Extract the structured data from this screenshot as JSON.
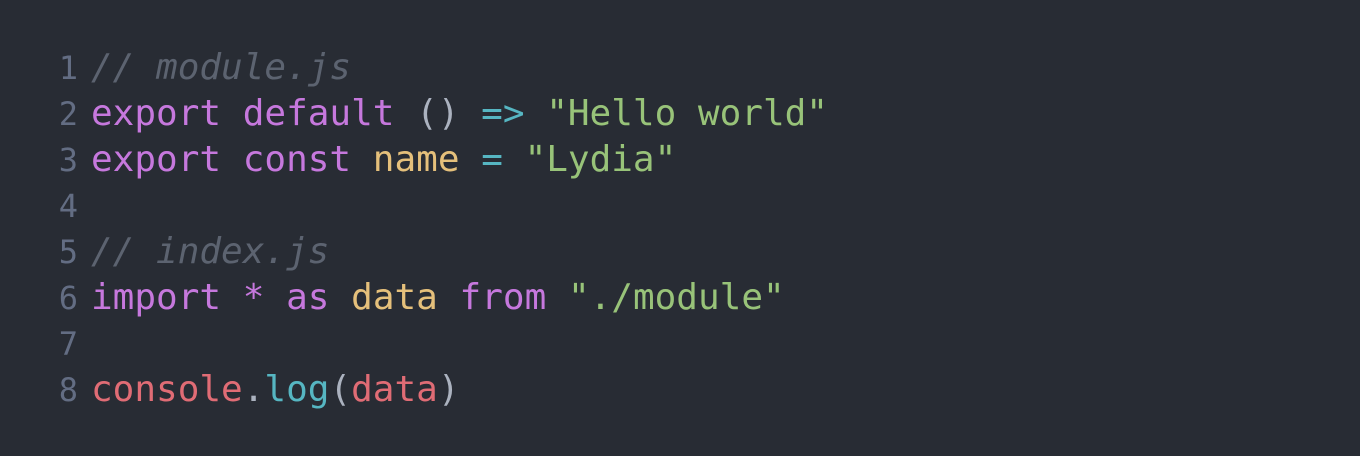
{
  "colors": {
    "background": "#282c34",
    "line_number": "#636d83",
    "comment": "#5c6370",
    "keyword": "#c678dd",
    "operator": "#56b6c2",
    "string": "#98c379",
    "variable": "#e5c07b",
    "plain": "#abb2bf",
    "object": "#e06c75",
    "method": "#56b6c2"
  },
  "code": {
    "lines": [
      {
        "number": "1",
        "tokens": [
          {
            "text": "// module.js",
            "type": "comment"
          }
        ]
      },
      {
        "number": "2",
        "tokens": [
          {
            "text": "export",
            "type": "keyword"
          },
          {
            "text": " ",
            "type": "plain"
          },
          {
            "text": "default",
            "type": "keyword"
          },
          {
            "text": " () ",
            "type": "plain"
          },
          {
            "text": "=>",
            "type": "operator"
          },
          {
            "text": " ",
            "type": "plain"
          },
          {
            "text": "\"Hello world\"",
            "type": "string"
          }
        ]
      },
      {
        "number": "3",
        "tokens": [
          {
            "text": "export",
            "type": "keyword"
          },
          {
            "text": " ",
            "type": "plain"
          },
          {
            "text": "const",
            "type": "keyword"
          },
          {
            "text": " ",
            "type": "plain"
          },
          {
            "text": "name",
            "type": "variable"
          },
          {
            "text": " ",
            "type": "plain"
          },
          {
            "text": "=",
            "type": "operator"
          },
          {
            "text": " ",
            "type": "plain"
          },
          {
            "text": "\"Lydia\"",
            "type": "string"
          }
        ]
      },
      {
        "number": "4",
        "tokens": []
      },
      {
        "number": "5",
        "tokens": [
          {
            "text": "// index.js",
            "type": "comment"
          }
        ]
      },
      {
        "number": "6",
        "tokens": [
          {
            "text": "import",
            "type": "keyword"
          },
          {
            "text": " ",
            "type": "plain"
          },
          {
            "text": "*",
            "type": "keyword"
          },
          {
            "text": " ",
            "type": "plain"
          },
          {
            "text": "as",
            "type": "keyword"
          },
          {
            "text": " ",
            "type": "plain"
          },
          {
            "text": "data",
            "type": "variable"
          },
          {
            "text": " ",
            "type": "plain"
          },
          {
            "text": "from",
            "type": "keyword"
          },
          {
            "text": " ",
            "type": "plain"
          },
          {
            "text": "\"./module\"",
            "type": "string"
          }
        ]
      },
      {
        "number": "7",
        "tokens": []
      },
      {
        "number": "8",
        "tokens": [
          {
            "text": "console",
            "type": "object"
          },
          {
            "text": ".",
            "type": "plain"
          },
          {
            "text": "log",
            "type": "method"
          },
          {
            "text": "(",
            "type": "plain"
          },
          {
            "text": "data",
            "type": "object"
          },
          {
            "text": ")",
            "type": "plain"
          }
        ]
      }
    ]
  }
}
